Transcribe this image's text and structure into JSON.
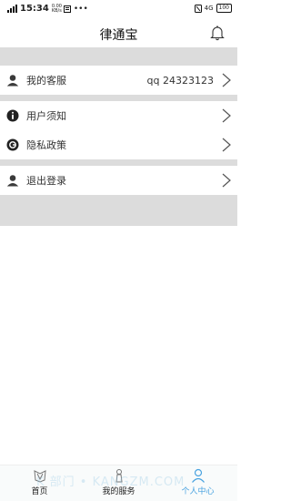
{
  "status": {
    "time": "15:34",
    "net_speed": "0.00 KB/s",
    "network": "4G",
    "battery": "100"
  },
  "header": {
    "title": "律通宝"
  },
  "menu": {
    "service": {
      "label": "我的客服",
      "value": "qq 24323123"
    },
    "notice": {
      "label": "用户须知"
    },
    "privacy": {
      "label": "隐私政策"
    },
    "logout": {
      "label": "退出登录"
    }
  },
  "tabs": [
    {
      "label": "首页"
    },
    {
      "label": "我的服务"
    },
    {
      "label": "个人中心"
    }
  ],
  "watermark": "K 部门 • KANGZM.COM",
  "colors": {
    "accent": "#4aa3e0",
    "section_gap": "#dcdcdc"
  }
}
